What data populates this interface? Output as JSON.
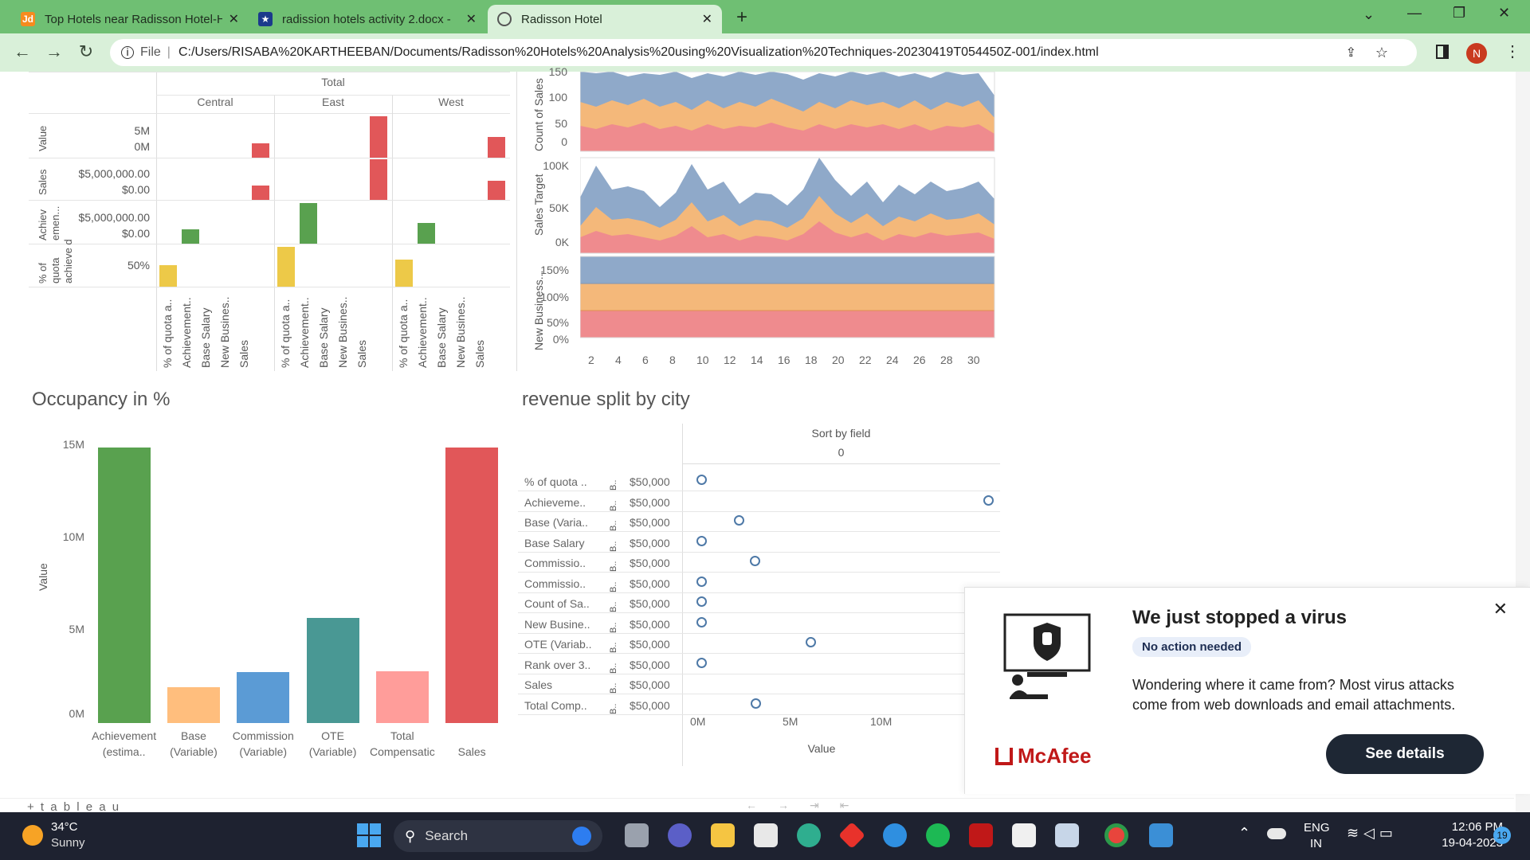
{
  "browser": {
    "tabs": [
      {
        "label": "Top Hotels near Radisson Hotel-H",
        "icon": "justdial-icon"
      },
      {
        "label": "radission hotels activity 2.docx - ",
        "icon": "word-icon"
      },
      {
        "label": "Radisson Hotel",
        "icon": "globe-icon"
      }
    ],
    "file_label": "File",
    "url": "C:/Users/RISABA%20KARTHEEBAN/Documents/Radisson%20Hotels%20Analysis%20using%20Visualization%20Techniques-20230419T054450Z-001/index.html",
    "profile_initial": "N"
  },
  "kpi_table": {
    "header_total": "Total",
    "regions": [
      "Central",
      "East",
      "West"
    ],
    "row_labels": [
      "Value",
      "Sales",
      "Achiev emen...",
      "% of quota achieve d"
    ],
    "value_ticks": [
      "5M",
      "0M"
    ],
    "sales_ticks": [
      "$5,000,000.00",
      "$0.00"
    ],
    "ach_ticks": [
      "$5,000,000.00",
      "$0.00"
    ],
    "pct_ticks": [
      "50%"
    ],
    "columns": [
      "% of quota a..",
      "Achievement..",
      "Base Salary",
      "New Busines..",
      "Sales"
    ]
  },
  "area_chart": {
    "y_labels": [
      "Count of Sales",
      "Sales Target",
      "New Business..."
    ],
    "count_ticks": [
      "150",
      "100",
      "50",
      "0"
    ],
    "target_ticks": [
      "100K",
      "50K",
      "0K"
    ],
    "nb_ticks": [
      "150%",
      "100%",
      "50%",
      "0%"
    ],
    "x_ticks": [
      "2",
      "4",
      "6",
      "8",
      "10",
      "12",
      "14",
      "16",
      "18",
      "20",
      "22",
      "24",
      "26",
      "28",
      "30"
    ],
    "colors": {
      "blue": "#8fa9c9",
      "orange": "#f4b87a",
      "red": "#ef8b8e"
    }
  },
  "occupancy": {
    "title": "Occupancy in %",
    "ylabel": "Value",
    "y_ticks": [
      "15M",
      "10M",
      "5M",
      "0M"
    ]
  },
  "chart_data": {
    "type": "bar",
    "title": "Occupancy in %",
    "ylabel": "Value",
    "categories": [
      "Achievement (estima..",
      "Base (Variable)",
      "Commission (Variable)",
      "OTE (Variable)",
      "Total Compensatic",
      "Sales"
    ],
    "cat_lines": [
      [
        "Achievement",
        "(estima.."
      ],
      [
        "Base",
        "(Variable)"
      ],
      [
        "Commission",
        "(Variable)"
      ],
      [
        "OTE",
        "(Variable)"
      ],
      [
        "Total",
        "Compensatic"
      ],
      [
        "",
        "Sales"
      ]
    ],
    "values": [
      15400000,
      2000000,
      2850000,
      5850000,
      2900000,
      15400000
    ],
    "colors": [
      "#59a14f",
      "#ffbe7d",
      "#5b9bd5",
      "#499894",
      "#ff9d9a",
      "#e15759"
    ],
    "ylim": [
      0,
      16000000
    ]
  },
  "revenue": {
    "title": "revenue split by city",
    "sort_label": "Sort by field",
    "sort_value": "0",
    "xlabel": "Value",
    "x_ticks": [
      "0M",
      "5M",
      "10M"
    ],
    "rows": [
      {
        "label": "% of quota ..",
        "b": "B..",
        "amount": "$50,000",
        "value": 0
      },
      {
        "label": "Achieveme..",
        "b": "B..",
        "amount": "$50,000",
        "value": 15400000
      },
      {
        "label": "Base (Varia..",
        "b": "B..",
        "amount": "$50,000",
        "value": 2000000
      },
      {
        "label": "Base Salary",
        "b": "B..",
        "amount": "$50,000",
        "value": 0
      },
      {
        "label": "Commissio..",
        "b": "B..",
        "amount": "$50,000",
        "value": 2850000
      },
      {
        "label": "Commissio..",
        "b": "B..",
        "amount": "$50,000",
        "value": 0
      },
      {
        "label": "Count of Sa..",
        "b": "B..",
        "amount": "$50,000",
        "value": 0
      },
      {
        "label": "New Busine..",
        "b": "B..",
        "amount": "$50,000",
        "value": 0
      },
      {
        "label": "OTE (Variab..",
        "b": "B..",
        "amount": "$50,000",
        "value": 5850000
      },
      {
        "label": "Rank over 3..",
        "b": "B..",
        "amount": "$50,000",
        "value": 0
      },
      {
        "label": "Sales",
        "b": "B..",
        "amount": "$50,000",
        "value": null
      },
      {
        "label": "Total Comp..",
        "b": "B..",
        "amount": "$50,000",
        "value": 2900000
      }
    ]
  },
  "tableau": {
    "logo": "+ t a b l e a u"
  },
  "popup": {
    "title": "We just stopped a virus",
    "badge": "No action needed",
    "body": "Wondering where it came from? Most virus attacks come from web downloads and email attachments.",
    "brand": "McAfee",
    "button": "See details"
  },
  "taskbar": {
    "weather_temp": "34°C",
    "weather_desc": "Sunny",
    "search": "Search",
    "lang": "ENG",
    "region": "IN",
    "time": "12:06 PM",
    "date": "19-04-2023",
    "notif_count": "19"
  }
}
